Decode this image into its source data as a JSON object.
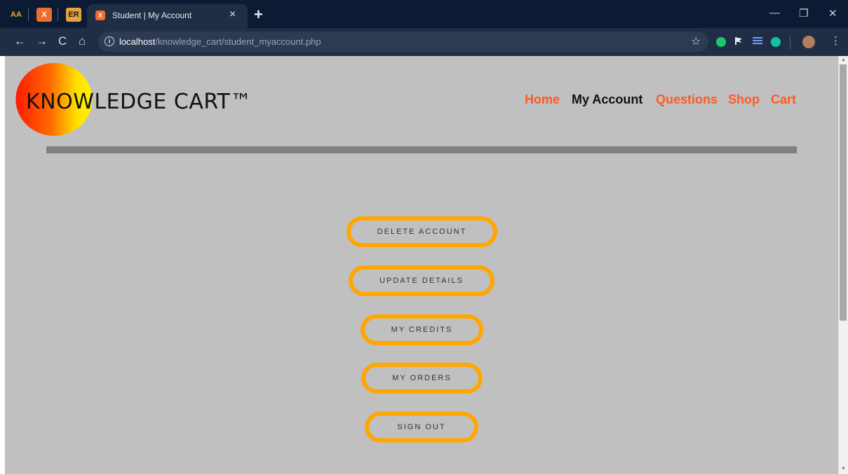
{
  "browser": {
    "pinned_tabs": [
      {
        "icon": "deploy-icon",
        "label": "AA"
      },
      {
        "icon": "xampp-icon",
        "label": "X"
      },
      {
        "icon": "er-icon",
        "label": "ER"
      }
    ],
    "active_tab": {
      "favicon": "xampp-icon",
      "favicon_label": "X",
      "title": "Student | My Account",
      "close": "×"
    },
    "new_tab": "+",
    "window_controls": [
      "—",
      "❐",
      "✕"
    ],
    "nav": {
      "back": "←",
      "forward": "→",
      "reload": "C",
      "home": "⌂"
    },
    "url_host": "localhost",
    "url_path": "/knowledge_cart/student_myaccount.php",
    "extensions": [
      {
        "name": "green-dot-icon",
        "color": "#1ec46d"
      },
      {
        "name": "flag-icon",
        "color": "#e8eaed"
      },
      {
        "name": "stack-icon",
        "color": "#6f9cf6"
      },
      {
        "name": "grammarly-icon",
        "color": "#15c39a"
      }
    ]
  },
  "site": {
    "logo_text": "KNOWLEDGE CART™",
    "nav": [
      {
        "label": "Home",
        "active": false
      },
      {
        "label": "My Account",
        "active": true
      },
      {
        "label": "Questions",
        "active": false
      },
      {
        "label": "Shop",
        "active": false
      },
      {
        "label": "Cart",
        "active": false
      }
    ],
    "actions": [
      {
        "label": "DELETE ACCOUNT"
      },
      {
        "label": "UPDATE DETAILS"
      },
      {
        "label": "MY CREDITS"
      },
      {
        "label": "MY ORDERS"
      },
      {
        "label": "SIGN OUT"
      }
    ]
  },
  "colors": {
    "accent": "#ff5a1f",
    "pill_border": "#ffa600",
    "page_bg": "#c0c0c0",
    "divider": "#808080"
  }
}
